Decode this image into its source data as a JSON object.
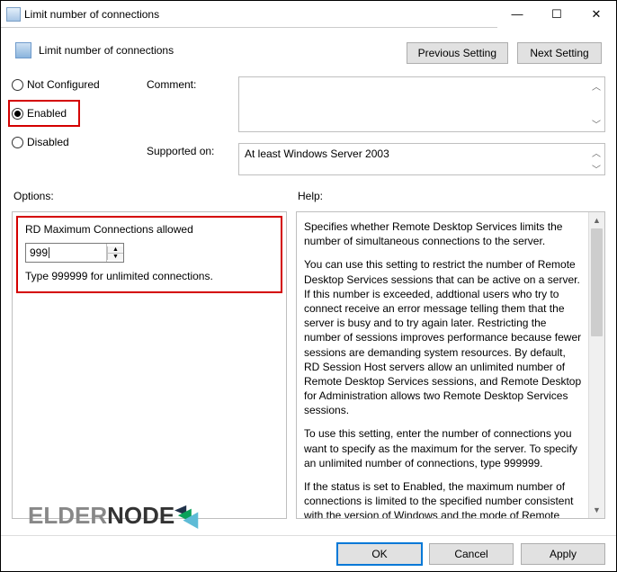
{
  "window": {
    "title": "Limit number of connections"
  },
  "dialog": {
    "heading": "Limit number of connections",
    "buttons": {
      "prev": "Previous Setting",
      "next": "Next Setting"
    }
  },
  "radio": {
    "not_configured": "Not Configured",
    "enabled": "Enabled",
    "disabled": "Disabled",
    "selected": "enabled"
  },
  "fields": {
    "comment_label": "Comment:",
    "comment_value": "",
    "supported_label": "Supported on:",
    "supported_value": "At least Windows Server 2003"
  },
  "section_labels": {
    "options": "Options:",
    "help": "Help:"
  },
  "options": {
    "label": "RD Maximum Connections allowed",
    "value": "999",
    "hint": "Type 999999 for unlimited connections."
  },
  "help": {
    "p1": "Specifies whether Remote Desktop Services limits the number of simultaneous connections to the server.",
    "p2": "You can use this setting to restrict the number of Remote Desktop Services sessions that can be active on a server. If this number is exceeded, addtional users who try to connect receive an error message telling them that the server is busy and to try again later. Restricting the number of sessions improves performance because fewer sessions are demanding system resources. By default, RD Session Host servers allow an unlimited number of Remote Desktop Services sessions, and Remote Desktop for Administration allows two Remote Desktop Services sessions.",
    "p3": "To use this setting, enter the number of connections you want to specify as the maximum for the server. To specify an unlimited number of connections, type 999999.",
    "p4": "If the status is set to Enabled, the maximum number of connections is limited to the specified number consistent with the version of Windows and the mode of Remote Desktop"
  },
  "footer": {
    "ok": "OK",
    "cancel": "Cancel",
    "apply": "Apply"
  },
  "logo": {
    "text_gray": "ELDER",
    "text_dark": "NODE"
  }
}
